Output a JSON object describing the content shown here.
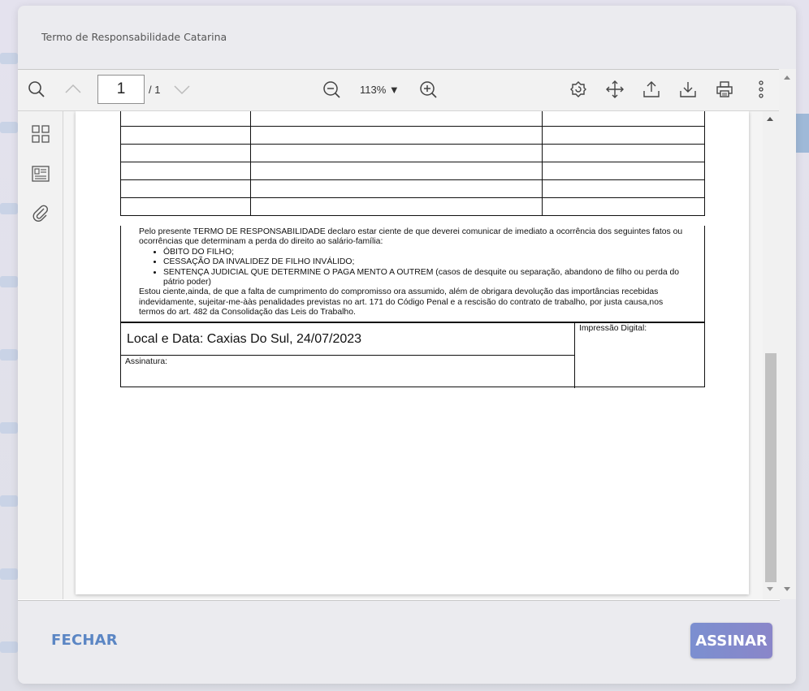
{
  "modal": {
    "title": "Termo de Responsabilidade Catarina"
  },
  "toolbar": {
    "page_value": "1",
    "page_total": "/ 1",
    "zoom": "113% ▼"
  },
  "document": {
    "terms_intro": "Pelo presente TERMO DE RESPONSABILIDADE declaro estar ciente de que deverei comunicar de imediato a ocorrência dos seguintes fatos ou ocorrências que determinam a perda do direito ao salário-família:",
    "terms_items": [
      "ÓBITO DO FILHO;",
      "CESSAÇÃO DA INVALIDEZ DE FILHO INVÁLIDO;",
      "SENTENÇA JUDICIAL QUE DETERMINE O PAGA MENTO A OUTREM (casos de desquite ou separação, abandono de filho ou perda do pátrio poder)"
    ],
    "terms_closing": "Estou ciente,ainda, de que a falta de cumprimento do compromisso ora assumido, além de obrigara devolução das importâncias recebidas indevidamente, sujeitar-me-ààs penalidades previstas no art. 171 do Código Penal e a rescisão do contrato de trabalho, por justa causa,nos termos do art. 482 da Consolidação das Leis do Trabalho.",
    "location_date": "Local e Data: Caxias Do Sul, 24/07/2023",
    "signature_label": "Assinatura:",
    "fingerprint_label": "Impressão Digital:"
  },
  "actions": {
    "close_label": "FECHAR",
    "sign_label": "ASSINAR"
  },
  "colors": {
    "close_text": "#5b86c4",
    "sign_gradient_start": "#7b8fd0",
    "sign_gradient_end": "#8a86c9"
  },
  "icons": [
    "search-icon",
    "chevron-up-icon",
    "chevron-down-icon",
    "zoom-out-icon",
    "zoom-in-icon",
    "rotate-icon",
    "pan-icon",
    "share-icon",
    "download-icon",
    "print-icon",
    "more-icon",
    "thumbnails-icon",
    "outline-icon",
    "attachment-icon"
  ]
}
